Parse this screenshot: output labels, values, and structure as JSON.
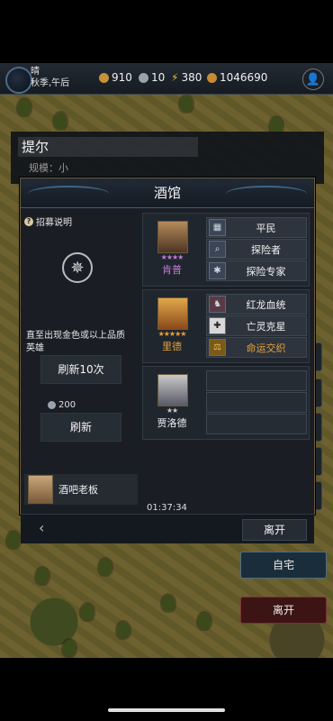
{
  "topbar": {
    "weather": "晴",
    "season_time": "秋季,午后",
    "resources": [
      {
        "name": "gold",
        "icon": "gold-coin-icon",
        "value": "910",
        "color": "#c8913a"
      },
      {
        "name": "silver",
        "icon": "silver-coin-icon",
        "value": "10",
        "color": "#9aa3ab"
      },
      {
        "name": "energy",
        "icon": "lightning-icon",
        "value": "380",
        "color": "#e2c13a"
      },
      {
        "name": "wood",
        "icon": "wood-icon",
        "value": "1046690",
        "color": "#c98a34"
      }
    ]
  },
  "city": {
    "name": "提尔",
    "scale_label": "规模：",
    "scale_value": "小"
  },
  "tavern": {
    "title": "酒馆",
    "help_label": "招募说明",
    "until_text": "直至出现金色或以上品质英雄",
    "refresh10_label": "刷新10次",
    "cost_value": "200",
    "refresh_label": "刷新",
    "keeper_label": "酒吧老板",
    "timer": "01:37:34",
    "leave_label": "离开",
    "heroes": [
      {
        "name": "肯普",
        "name_color": "#c47ad8",
        "stars": "★★★★",
        "star_color": "#c47ad8",
        "rarity": "purple",
        "traits": [
          {
            "icon": "chip-icon",
            "label": "平民",
            "color": "#f2f2f2"
          },
          {
            "icon": "telescope-icon",
            "label": "探险者",
            "color": "#f2f2f2"
          },
          {
            "icon": "expert-icon",
            "label": "探险专家",
            "color": "#f2f2f2"
          }
        ]
      },
      {
        "name": "里德",
        "name_color": "#e8a23a",
        "stars": "★★★★★",
        "star_color": "#e8a23a",
        "rarity": "gold",
        "traits": [
          {
            "icon": "dragon-icon",
            "label": "红龙血统",
            "color": "#f2f2f2"
          },
          {
            "icon": "shield-icon",
            "label": "亡灵克星",
            "color": "#f2f2f2"
          },
          {
            "icon": "scales-icon",
            "label": "命运交织",
            "color": "#e8a23a"
          }
        ]
      },
      {
        "name": "贾洛德",
        "name_color": "#f2f2f2",
        "stars": "★★",
        "star_color": "#c8c8c8",
        "rarity": "white",
        "traits": []
      }
    ]
  },
  "side": {
    "home_label": "自宅",
    "leave_label": "离开"
  }
}
